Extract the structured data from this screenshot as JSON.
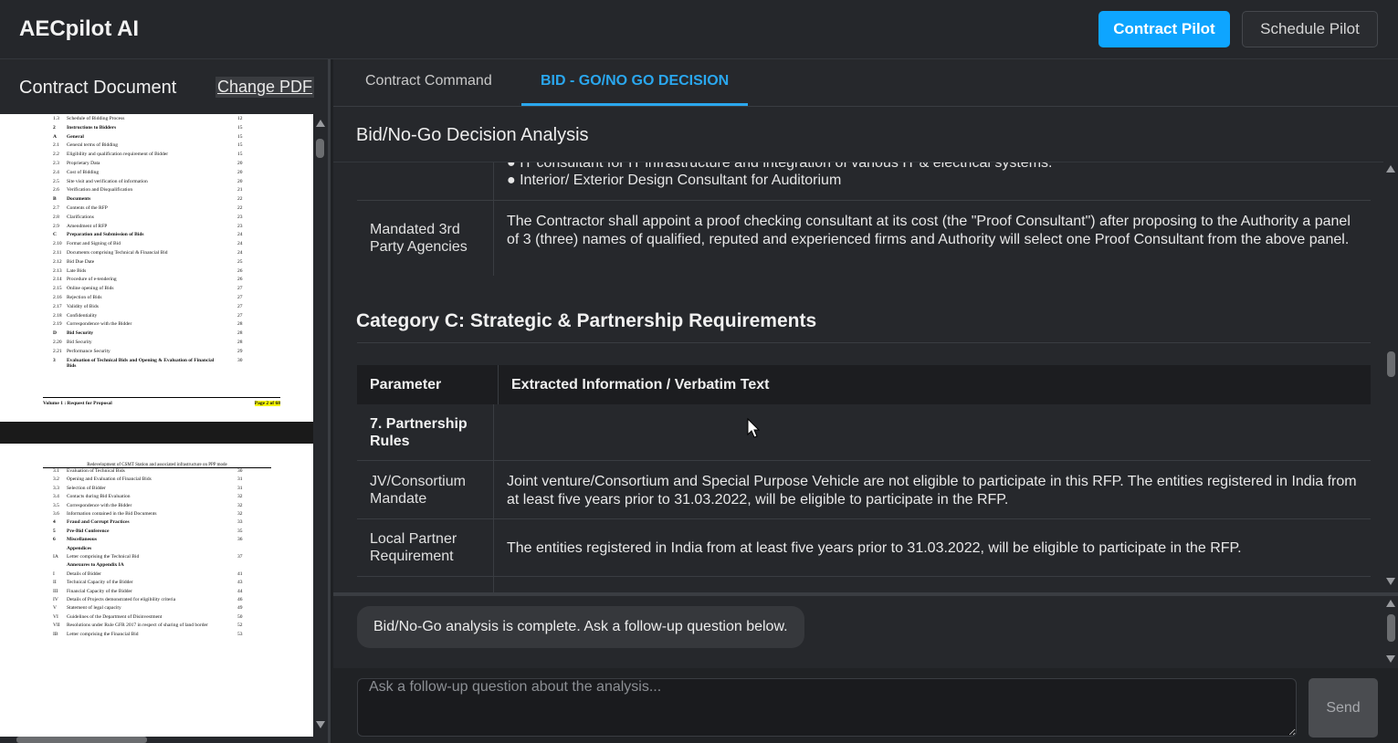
{
  "header": {
    "app_title": "AECpilot AI",
    "buttons": {
      "contract_pilot": "Contract Pilot",
      "schedule_pilot": "Schedule Pilot"
    }
  },
  "left_panel": {
    "title": "Contract Document",
    "change_pdf": "Change PDF",
    "page1": {
      "lines": [
        {
          "num": "1.3",
          "label": "Schedule of Bidding Process",
          "page": "12"
        },
        {
          "num": "2",
          "label": "Instructions to Bidders",
          "page": "15",
          "bold": true
        },
        {
          "num": "A",
          "label": "General",
          "page": "15",
          "bold": true
        },
        {
          "num": "2.1",
          "label": "General terms of Bidding",
          "page": "15"
        },
        {
          "num": "2.2",
          "label": "Eligibility and qualification requirement of Bidder",
          "page": "15"
        },
        {
          "num": "2.3",
          "label": "Proprietary Data",
          "page": "20"
        },
        {
          "num": "2.4",
          "label": "Cost of Bidding",
          "page": "20"
        },
        {
          "num": "2.5",
          "label": "Site visit and verification of information",
          "page": "20"
        },
        {
          "num": "2.6",
          "label": "Verification and Disqualification",
          "page": "21"
        },
        {
          "num": "B",
          "label": "Documents",
          "page": "22",
          "bold": true
        },
        {
          "num": "2.7",
          "label": "Contents of the RFP",
          "page": "22"
        },
        {
          "num": "2.8",
          "label": "Clarifications",
          "page": "23"
        },
        {
          "num": "2.9",
          "label": "Amendment of RFP",
          "page": "23"
        },
        {
          "num": "C",
          "label": "Preparation and Submission of Bids",
          "page": "24",
          "bold": true
        },
        {
          "num": "2.10",
          "label": "Format and Signing of Bid",
          "page": "24"
        },
        {
          "num": "2.11",
          "label": "Documents comprising Technical & Financial Bid",
          "page": "24"
        },
        {
          "num": "2.12",
          "label": "Bid Due Date",
          "page": "25"
        },
        {
          "num": "2.13",
          "label": "Late Bids",
          "page": "26"
        },
        {
          "num": "2.14",
          "label": "Procedure of e-tendering",
          "page": "26"
        },
        {
          "num": "2.15",
          "label": "Online opening of Bids",
          "page": "27"
        },
        {
          "num": "2.16",
          "label": "Rejection of Bids",
          "page": "27"
        },
        {
          "num": "2.17",
          "label": "Validity of Bids",
          "page": "27"
        },
        {
          "num": "2.18",
          "label": "Confidentiality",
          "page": "27"
        },
        {
          "num": "2.19",
          "label": "Correspondence with the Bidder",
          "page": "28"
        },
        {
          "num": "D",
          "label": "Bid Security",
          "page": "28",
          "bold": true
        },
        {
          "num": "2.20",
          "label": "Bid Security",
          "page": "28"
        },
        {
          "num": "2.21",
          "label": "Performance Security",
          "page": "29"
        },
        {
          "num": "3",
          "label": "Evaluation of Technical Bids and Opening & Evaluation of Financial Bids",
          "page": "30",
          "bold": true
        }
      ],
      "footer_left": "Volume 1 : Request for Proposal",
      "footer_right": "Page 2 of 68"
    },
    "page2": {
      "header": "Redevelopment of CSMT Station and associated infrastructure on PPP mode",
      "lines": [
        {
          "num": "3.1",
          "label": "Evaluation of Technical Bids",
          "page": "30"
        },
        {
          "num": "3.2",
          "label": "Opening and Evaluation of Financial Bids",
          "page": "31"
        },
        {
          "num": "3.3",
          "label": "Selection of Bidder",
          "page": "31"
        },
        {
          "num": "3.4",
          "label": "Contacts during Bid Evaluation",
          "page": "32"
        },
        {
          "num": "3.5",
          "label": "Correspondence with the Bidder",
          "page": "32"
        },
        {
          "num": "3.6",
          "label": "Information contained in the Bid Documents",
          "page": "32"
        },
        {
          "num": "4",
          "label": "Fraud and Corrupt Practices",
          "page": "33",
          "bold": true
        },
        {
          "num": "5",
          "label": "Pre-Bid Conference",
          "page": "35",
          "bold": true
        },
        {
          "num": "6",
          "label": "Miscellaneous",
          "page": "36",
          "bold": true
        },
        {
          "num": "",
          "label": "Appendices",
          "page": "",
          "bold": true
        },
        {
          "num": "IA",
          "label": "Letter comprising the Technical Bid",
          "page": "37"
        },
        {
          "num": "",
          "label": "Annexures to Appendix IA",
          "page": "",
          "bold": true
        },
        {
          "num": "I",
          "label": "Details of Bidder",
          "page": "41"
        },
        {
          "num": "II",
          "label": "Technical Capacity of the Bidder",
          "page": "43"
        },
        {
          "num": "III",
          "label": "Financial Capacity of the Bidder",
          "page": "44"
        },
        {
          "num": "IV",
          "label": "Details of Projects demonstrated for eligibility criteria",
          "page": "46"
        },
        {
          "num": "V",
          "label": "Statement of legal capacity",
          "page": "49"
        },
        {
          "num": "VI",
          "label": "Guidelines of the Department of Disinvestment",
          "page": "50"
        },
        {
          "num": "VII",
          "label": "Resolutions under Rule GFR 2017 in respect of sharing of land border",
          "page": "52"
        },
        {
          "num": "IB",
          "label": "Letter comprising the Financial Bid",
          "page": "53"
        }
      ]
    }
  },
  "main": {
    "tabs": [
      {
        "label": "Contract Command",
        "active": false
      },
      {
        "label": "BID - GO/NO GO DECISION",
        "active": true
      }
    ],
    "section_title": "Bid/No-Go Decision Analysis",
    "prev_table": {
      "bullets": [
        "● IT consultant for IT infrastructure and integration of various IT & electrical systems.",
        "● Interior/ Exterior Design Consultant for Auditorium"
      ],
      "row": {
        "param": "Mandated 3rd Party Agencies",
        "text": "The Contractor shall appoint a proof checking consultant at its cost (the \"Proof Consultant\") after proposing to the Authority a panel of 3 (three) names of qualified, reputed and experienced firms and Authority will select one Proof Consultant from the above panel."
      }
    },
    "category_heading": "Category C: Strategic & Partnership Requirements",
    "table": {
      "headers": [
        "Parameter",
        "Extracted Information / Verbatim Text"
      ],
      "rows": [
        {
          "param": "7. Partnership Rules",
          "text": "",
          "bold": true
        },
        {
          "param": "JV/Consortium Mandate",
          "text": "Joint venture/Consortium and Special Purpose Vehicle are not eligible to participate in this RFP. The entities registered in India from at least five years prior to 31.03.2022, will be eligible to participate in the RFP."
        },
        {
          "param": "Local Partner Requirement",
          "text": "The entities registered in India from at least five years prior to 31.03.2022, will be eligible to participate in the RFP."
        }
      ]
    },
    "chat": {
      "message": "Bid/No-Go analysis is complete. Ask a follow-up question below."
    },
    "input": {
      "placeholder": "Ask a follow-up question about the analysis...",
      "send_label": "Send"
    }
  },
  "colors": {
    "accent": "#0ea5ff",
    "tab_active": "#2aa7ee",
    "background": "#26282c"
  }
}
